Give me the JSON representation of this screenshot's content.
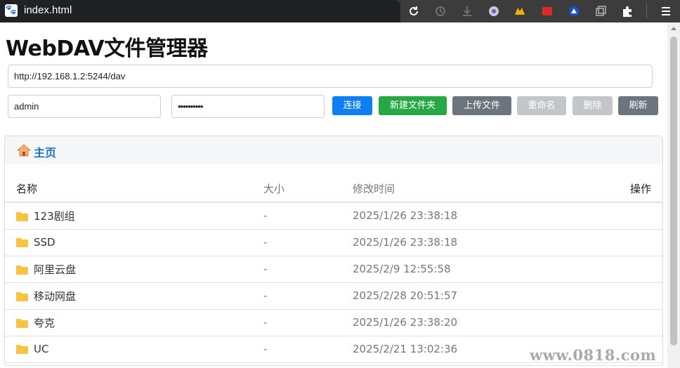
{
  "browser": {
    "tab_title": "index.html",
    "favicon": "paw-icon",
    "toolbar_icons": [
      "reload-icon",
      "history-icon",
      "download-icon",
      "extension-globe-icon",
      "extension-cat-icon",
      "extension-red-icon",
      "extension-blue-icon",
      "tab-search-icon",
      "puzzle-icon",
      "menu-icon"
    ]
  },
  "page": {
    "title": "WebDAV文件管理器",
    "url_value": "http://192.168.1.2:5244/dav",
    "username_value": "admin",
    "password_value": "••••••••••"
  },
  "toolbar": {
    "connect_label": "连接",
    "new_folder_label": "新建文件夹",
    "upload_label": "上传文件",
    "rename_label": "重命名",
    "delete_label": "删除",
    "refresh_label": "刷新"
  },
  "colors": {
    "connect": "#0d7ff2",
    "new_folder": "#28a745",
    "upload": "#6c757d",
    "rename_disabled": "#c3c6c9",
    "delete_disabled": "#c3c6c9",
    "refresh": "#6c757d",
    "breadcrumb_link": "#1a73c9",
    "folder": "#f6c343"
  },
  "breadcrumb": {
    "home_label": "主页"
  },
  "table": {
    "headers": {
      "name": "名称",
      "size": "大小",
      "modified": "修改时间",
      "actions": "操作"
    },
    "rows": [
      {
        "name": "123剧组",
        "size": "-",
        "modified": "2025/1/26 23:38:18"
      },
      {
        "name": "SSD",
        "size": "-",
        "modified": "2025/1/26 23:38:18"
      },
      {
        "name": "阿里云盘",
        "size": "-",
        "modified": "2025/2/9 12:55:58"
      },
      {
        "name": "移动网盘",
        "size": "-",
        "modified": "2025/2/28 20:51:57"
      },
      {
        "name": "夸克",
        "size": "-",
        "modified": "2025/1/26 23:38:20"
      },
      {
        "name": "UC",
        "size": "-",
        "modified": "2025/2/21 13:02:36"
      }
    ]
  },
  "watermark": "www.0818.com"
}
